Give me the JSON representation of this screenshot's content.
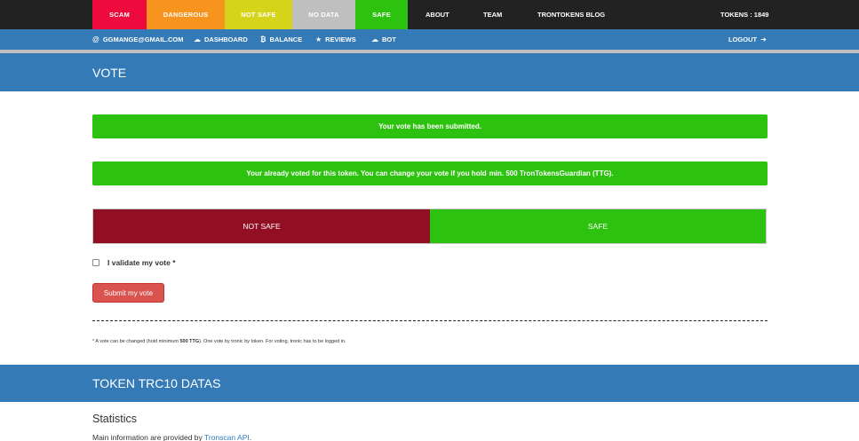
{
  "topnav": {
    "scam": "SCAM",
    "dangerous": "DANGEROUS",
    "not_safe": "NOT SAFE",
    "no_data": "NO DATA",
    "safe": "SAFE",
    "about": "ABOUT",
    "team": "TEAM",
    "blog": "TRONTOKENS BLOG",
    "tokens": "TOKENS : 1849",
    "colors": {
      "scam": "#ee0a3c",
      "dangerous": "#f7941d",
      "not_safe": "#d6d41a",
      "no_data": "#bfbfbf",
      "safe": "#2dc20f"
    }
  },
  "subnav": {
    "email": "GGMANGE@GMAIL.COM",
    "dashboard": "DASHBOARD",
    "balance": "BALANCE",
    "reviews": "REVIEWS",
    "bot": "BOT",
    "logout": "LOGOUT",
    "icons": {
      "email": "at-icon",
      "dashboard": "dashboard-icon",
      "balance": "bitcoin-icon",
      "reviews": "star-icon",
      "bot": "bot-icon",
      "logout": "logout-icon"
    }
  },
  "vote_section": {
    "title": "VOTE",
    "alert_submitted": "Your vote has been submitted.",
    "alert_already_voted": "Your already voted for this token. You can change your vote if you hold",
    "alert_already_voted_bold": "min. 500 TronTokensGuardian (TTG).",
    "not_safe_button": "NOT SAFE",
    "safe_button": "SAFE",
    "validate_label": "I validate my vote *",
    "submit_label": "Submit my vote",
    "footnote_prefix": "* A vote can be changed (hold minimum",
    "footnote_bold": "500 TTG",
    "footnote_suffix": "). One vote by tronic by token. For voting, tronic has to be logged in.",
    "colors": {
      "alert": "#2dc20f",
      "not_safe": "#920e23",
      "safe": "#2dc20f",
      "submit": "#d9534f"
    }
  },
  "trc_section": {
    "title": "TOKEN TRC10 DATAS",
    "stats_title": "Statistics",
    "stats_text_prefix": "Main information are provided by",
    "stats_link": "Tronscan API",
    "stats_text_suffix": "."
  }
}
